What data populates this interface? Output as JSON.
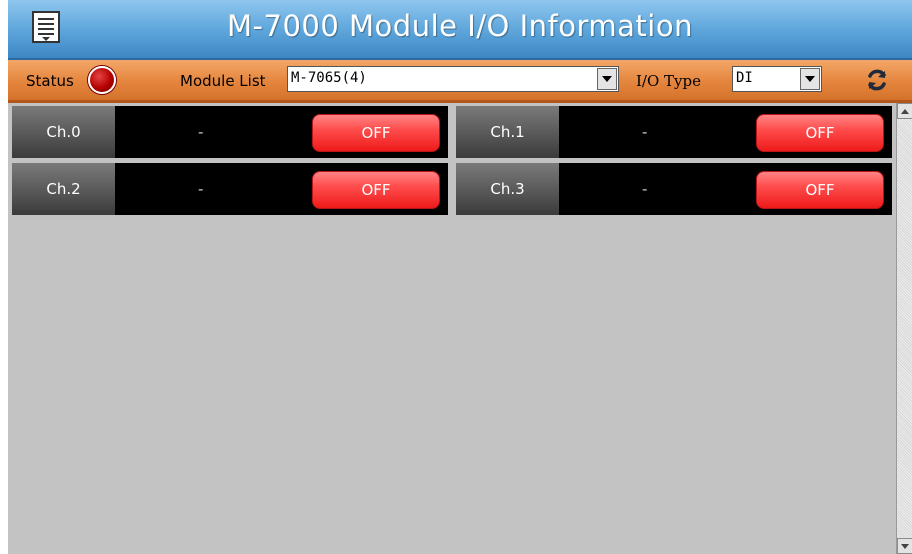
{
  "header": {
    "title": "M-7000 Module I/O Information",
    "menu_icon": "document-list-icon"
  },
  "toolbar": {
    "status_label": "Status",
    "status_color": "#b40000",
    "module_list_label": "Module List",
    "module_list_value": "M-7065(4)",
    "io_type_label": "I/O Type",
    "io_type_value": "DI",
    "refresh_icon": "refresh-icon"
  },
  "channels": [
    {
      "label": "Ch.0",
      "value": "-",
      "state": "OFF"
    },
    {
      "label": "Ch.1",
      "value": "-",
      "state": "OFF"
    },
    {
      "label": "Ch.2",
      "value": "-",
      "state": "OFF"
    },
    {
      "label": "Ch.3",
      "value": "-",
      "state": "OFF"
    }
  ],
  "colors": {
    "title_bar": "#5fa7dc",
    "toolbar": "#e4853e",
    "off_button": "#ff3a3a",
    "background": "#c3c3c3"
  }
}
